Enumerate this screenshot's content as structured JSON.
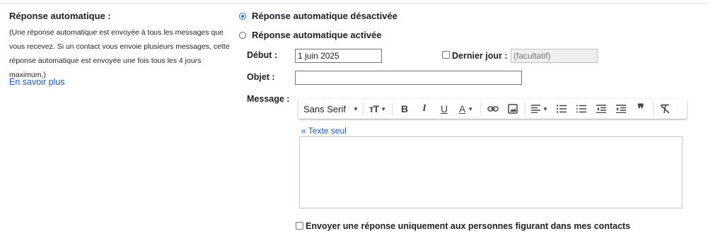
{
  "section": {
    "title": "Réponse automatique :",
    "description_lines": [
      "(Une réponse automatique est envoyée à tous les messages que",
      "vous recevez. Si un contact vous envoie plusieurs messages, cette",
      "réponse automatique est envoyée une fois tous les 4 jours",
      "maximum.)"
    ],
    "learn_more": "En savoir plus"
  },
  "radios": {
    "off_label": "Réponse automatique désactivée",
    "on_label": "Réponse automatique activée",
    "selected": "off"
  },
  "fields": {
    "start_label": "Début :",
    "start_value": "1 juin 2025",
    "last_day_label": "Dernier jour :",
    "last_day_placeholder": "(facultatif)",
    "subject_label": "Objet :",
    "subject_value": "",
    "message_label": "Message :"
  },
  "toolbar": {
    "font_name": "Sans Serif",
    "buttons": [
      "font-size",
      "bold",
      "italic",
      "underline",
      "text-color",
      "link",
      "image",
      "align",
      "numbered-list",
      "bulleted-list",
      "indent-less",
      "indent-more",
      "quote",
      "remove-formatting"
    ]
  },
  "editor": {
    "plain_text_link": "« Texte seul",
    "body": ""
  },
  "contacts_only_label": "Envoyer une réponse uniquement aux personnes figurant dans mes contacts",
  "colors": {
    "accent": "#1a73e8",
    "link": "#1a57c4"
  }
}
